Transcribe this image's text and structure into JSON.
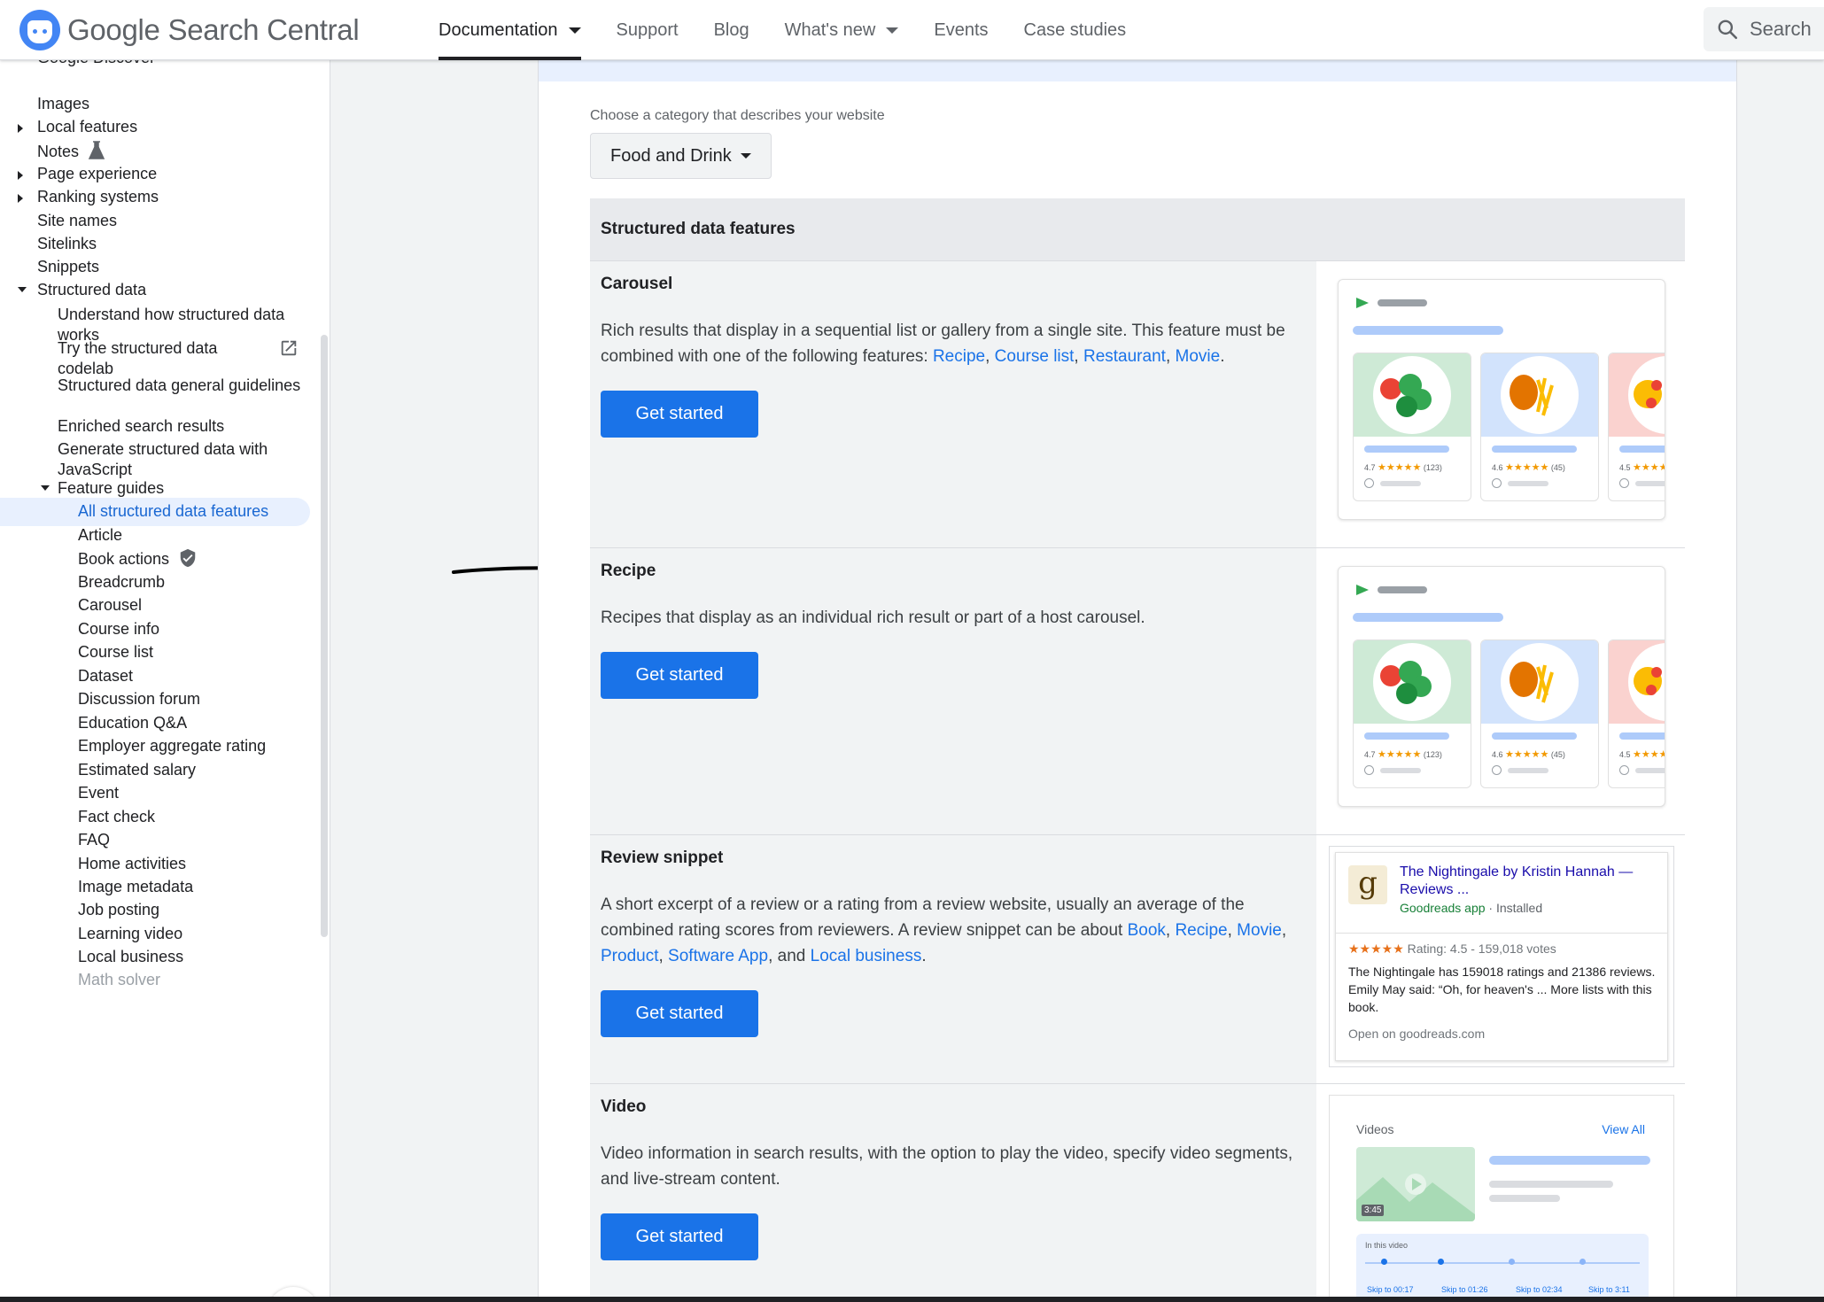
{
  "header": {
    "logo_text": "Google Search Central",
    "nav": [
      {
        "label": "Documentation",
        "has_caret": true,
        "active": true
      },
      {
        "label": "Support",
        "has_caret": false
      },
      {
        "label": "Blog",
        "has_caret": false
      },
      {
        "label": "What's new",
        "has_caret": true
      },
      {
        "label": "Events",
        "has_caret": false
      },
      {
        "label": "Case studies",
        "has_caret": false
      }
    ],
    "search_label": "Search"
  },
  "sidebar": {
    "cut_item": "Google Discover",
    "items": [
      {
        "label": "Images",
        "level": 1,
        "expander": "none"
      },
      {
        "label": "Local features",
        "level": 1,
        "expander": "right"
      },
      {
        "label": "Notes",
        "level": 1,
        "expander": "none",
        "icon": "flask-icon"
      },
      {
        "label": "Page experience",
        "level": 1,
        "expander": "right"
      },
      {
        "label": "Ranking systems",
        "level": 1,
        "expander": "right"
      },
      {
        "label": "Site names",
        "level": 1,
        "expander": "none"
      },
      {
        "label": "Sitelinks",
        "level": 1,
        "expander": "none"
      },
      {
        "label": "Snippets",
        "level": 1,
        "expander": "none"
      },
      {
        "label": "Structured data",
        "level": 1,
        "expander": "down"
      },
      {
        "label": "Understand how structured data works",
        "level": 2,
        "expander": "none"
      },
      {
        "label": "Try the structured data codelab",
        "level": 2,
        "expander": "none",
        "icon": "external-link-icon"
      },
      {
        "label": "Structured data general guidelines",
        "level": 2,
        "expander": "none"
      },
      {
        "label": "Enriched search results",
        "level": 2,
        "expander": "none"
      },
      {
        "label": "Generate structured data with JavaScript",
        "level": 2,
        "expander": "none"
      },
      {
        "label": "Feature guides",
        "level": 2,
        "expander": "down"
      },
      {
        "label": "All structured data features",
        "level": 3,
        "expander": "none",
        "selected": true
      },
      {
        "label": "Article",
        "level": 3,
        "expander": "none"
      },
      {
        "label": "Book actions",
        "level": 3,
        "expander": "none",
        "icon": "verified-shield-icon"
      },
      {
        "label": "Breadcrumb",
        "level": 3,
        "expander": "none"
      },
      {
        "label": "Carousel",
        "level": 3,
        "expander": "none"
      },
      {
        "label": "Course info",
        "level": 3,
        "expander": "none"
      },
      {
        "label": "Course list",
        "level": 3,
        "expander": "none"
      },
      {
        "label": "Dataset",
        "level": 3,
        "expander": "none"
      },
      {
        "label": "Discussion forum",
        "level": 3,
        "expander": "none"
      },
      {
        "label": "Education Q&A",
        "level": 3,
        "expander": "none"
      },
      {
        "label": "Employer aggregate rating",
        "level": 3,
        "expander": "none"
      },
      {
        "label": "Estimated salary",
        "level": 3,
        "expander": "none"
      },
      {
        "label": "Event",
        "level": 3,
        "expander": "none"
      },
      {
        "label": "Fact check",
        "level": 3,
        "expander": "none"
      },
      {
        "label": "FAQ",
        "level": 3,
        "expander": "none"
      },
      {
        "label": "Home activities",
        "level": 3,
        "expander": "none"
      },
      {
        "label": "Image metadata",
        "level": 3,
        "expander": "none"
      },
      {
        "label": "Job posting",
        "level": 3,
        "expander": "none"
      },
      {
        "label": "Learning video",
        "level": 3,
        "expander": "none"
      },
      {
        "label": "Local business",
        "level": 3,
        "expander": "none"
      },
      {
        "label": "Math solver",
        "level": 3,
        "expander": "none",
        "muted": true
      }
    ]
  },
  "content": {
    "category_label": "Choose a category that describes your website",
    "category_value": "Food and Drink",
    "table_header": "Structured data features",
    "button_label": "Get started",
    "rows": {
      "carousel": {
        "title": "Carousel",
        "desc_start": "Rich results that display in a sequential list or gallery from a single site. This feature must be combined with one of the following features: ",
        "links": [
          "Recipe",
          "Course list",
          "Restaurant",
          "Movie"
        ]
      },
      "recipe": {
        "title": "Recipe",
        "desc": "Recipes that display as an individual rich result or part of a host carousel."
      },
      "review": {
        "title": "Review snippet",
        "desc_start": "A short excerpt of a review or a rating from a review website, usually an average of the combined rating scores from reviewers. A review snippet can be about ",
        "links": [
          "Book",
          "Recipe",
          "Movie",
          "Product",
          "Software App",
          "Local business"
        ],
        "and_word": "and"
      },
      "video": {
        "title": "Video",
        "desc": "Video information in search results, with the option to play the video, specify video segments, and live-stream content."
      }
    },
    "recipe_preview": {
      "cards": [
        {
          "rating": "4.7",
          "count": "(123)"
        },
        {
          "rating": "4.6",
          "count": "(45)"
        },
        {
          "rating": "4.5",
          "count": ""
        }
      ],
      "stars": "★★★★★"
    },
    "review_preview": {
      "logo_letter": "g",
      "title": "The Nightingale by Kristin Hannah — Reviews ...",
      "app": "Goodreads app",
      "installed": "· Installed",
      "stars": "★★★★★",
      "rating": "Rating: 4.5 - 159,018 votes",
      "text": "The Nightingale has 159018 ratings and 21386 reviews. Emily May said: “Oh, for heaven's ... More lists with this book.",
      "open": "Open on goodreads.com"
    },
    "video_preview": {
      "label": "Videos",
      "view_all": "View All",
      "duration": "3:45",
      "in_video": "In this video",
      "skips": [
        "Skip to 00:17",
        "Skip to 01:26",
        "Skip to 02:34",
        "Skip to 3:11"
      ]
    }
  },
  "colors": {
    "accent": "#1a73e8",
    "selected_bg": "#e8f0fe",
    "selected_text": "#1967d2"
  }
}
